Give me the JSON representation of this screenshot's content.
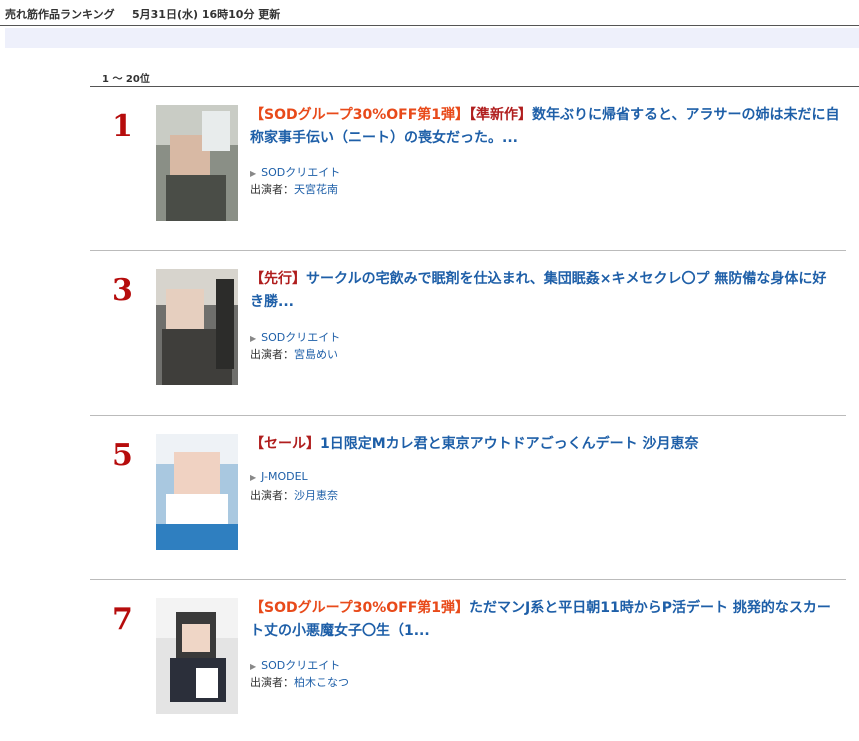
{
  "header": {
    "title": "売れ筋作品ランキング",
    "updated": "5月31日(水) 16時10分 更新"
  },
  "range_label": "1 〜 20位",
  "actor_prefix": "出演者：",
  "items": [
    {
      "rank": "1",
      "tag1": "【SODグループ30%OFF第1弾】",
      "tag2": "【準新作】",
      "title": "数年ぶりに帰省すると、アラサーの姉は未だに自称家事手伝い（ニート）の喪女だった。...",
      "maker": "SODクリエイト",
      "actor": "天宮花南"
    },
    {
      "rank": "3",
      "tag1": "【先行】",
      "title": "サークルの宅飲みで眠剤を仕込まれ、集団眠姦×キメセクレ〇プ 無防備な身体に好き勝...",
      "maker": "SODクリエイト",
      "actor": "宮島めい"
    },
    {
      "rank": "5",
      "tag1": "【セール】",
      "title": "1日限定Mカレ君と東京アウトドアごっくんデート 沙月恵奈",
      "maker": "J-MODEL",
      "actor": "沙月恵奈"
    },
    {
      "rank": "7",
      "tag1": "【SODグループ30%OFF第1弾】",
      "title": "ただマンJ系と平日朝11時からP活デート 挑発的なスカート丈の小悪魔女子〇生（1...",
      "maker": "SODクリエイト",
      "actor": "柏木こなつ"
    }
  ],
  "colors": {
    "rank": "#b60c0c",
    "title_link": "#1e5fa8",
    "tag_orange": "#e84a1a",
    "tag_red": "#b01e1e",
    "band": "#eef0fb"
  }
}
